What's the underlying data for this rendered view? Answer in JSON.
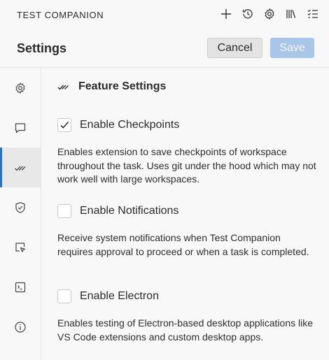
{
  "app": {
    "title": "TEST COMPANION"
  },
  "toolbar": {
    "icons": [
      "plus-icon",
      "history-icon",
      "gear-icon",
      "library-icon",
      "checklist-icon"
    ]
  },
  "header": {
    "title": "Settings",
    "cancel_label": "Cancel",
    "save_label": "Save"
  },
  "sidebar": {
    "items": [
      {
        "icon": "gear-icon",
        "active": false
      },
      {
        "icon": "chat-icon",
        "active": false
      },
      {
        "icon": "checkmarks-icon",
        "active": true
      },
      {
        "icon": "shield-icon",
        "active": false
      },
      {
        "icon": "pointer-icon",
        "active": false
      },
      {
        "icon": "terminal-icon",
        "active": false
      },
      {
        "icon": "info-icon",
        "active": false
      }
    ],
    "active_color": "#2f6fc2"
  },
  "main": {
    "section_title": "Feature Settings",
    "settings": [
      {
        "label": "Enable Checkpoints",
        "checked": true,
        "description": "Enables extension to save checkpoints of workspace throughout the task. Uses git under the hood which may not work well with large workspaces."
      },
      {
        "label": "Enable Notifications",
        "checked": false,
        "description": "Receive system notifications when Test Companion requires approval to proceed or when a task is completed."
      },
      {
        "label": "Enable Electron",
        "checked": false,
        "description": "Enables testing of Electron-based desktop applications like VS Code extensions and custom desktop apps."
      }
    ]
  }
}
